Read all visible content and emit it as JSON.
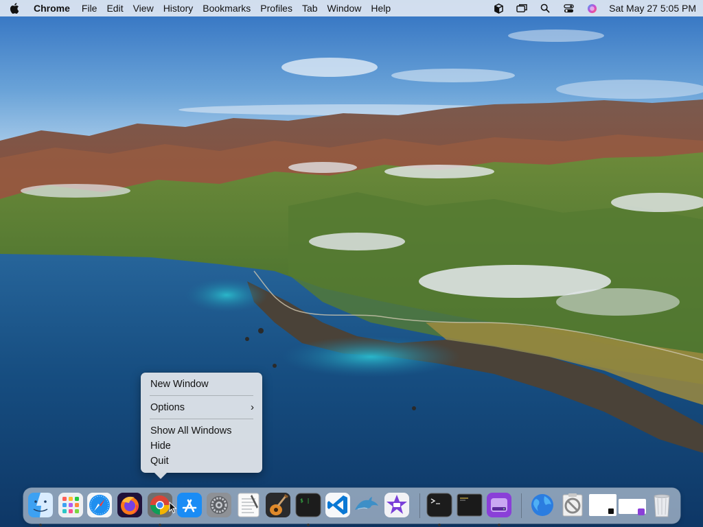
{
  "menubar": {
    "app_name": "Chrome",
    "menus": [
      "File",
      "Edit",
      "View",
      "History",
      "Bookmarks",
      "Profiles",
      "Tab",
      "Window",
      "Help"
    ],
    "status_icons": [
      "box-icon",
      "screen-mirror-icon",
      "search-icon",
      "control-center-icon",
      "siri-icon"
    ],
    "clock": "Sat May 27  5:05 PM"
  },
  "dock_menu": {
    "new_window": "New Window",
    "options": "Options",
    "show_all_windows": "Show All Windows",
    "hide": "Hide",
    "quit": "Quit"
  },
  "dock": {
    "apps": [
      {
        "name": "finder-icon",
        "running": true
      },
      {
        "name": "launchpad-icon",
        "running": false
      },
      {
        "name": "safari-icon",
        "running": false
      },
      {
        "name": "firefox-icon",
        "running": false
      },
      {
        "name": "chrome-icon",
        "running": true
      },
      {
        "name": "app-store-icon",
        "running": false
      },
      {
        "name": "system-preferences-icon",
        "running": false
      },
      {
        "name": "textedit-icon",
        "running": false
      },
      {
        "name": "garageband-icon",
        "running": false
      },
      {
        "name": "terminal-icon",
        "running": true
      },
      {
        "name": "vscode-icon",
        "running": false
      },
      {
        "name": "mysql-workbench-icon",
        "running": false
      },
      {
        "name": "imovie-icon",
        "running": false
      },
      {
        "name": "terminal-icon-2",
        "running": true
      },
      {
        "name": "console-icon",
        "running": false
      },
      {
        "name": "disk-utility-icon",
        "running": true
      },
      {
        "name": "network-globe-icon",
        "running": false
      },
      {
        "name": "directory-utility-icon",
        "running": false
      },
      {
        "name": "window-thumbnail-1",
        "running": false
      },
      {
        "name": "window-thumbnail-2",
        "running": false
      },
      {
        "name": "trash-icon",
        "running": false
      }
    ]
  },
  "colors": {
    "menu_bg": "#ecf0f6",
    "dock_bg": "#ebeff4",
    "ocean": "#1a4f7e",
    "sky": "#5b93cf"
  }
}
